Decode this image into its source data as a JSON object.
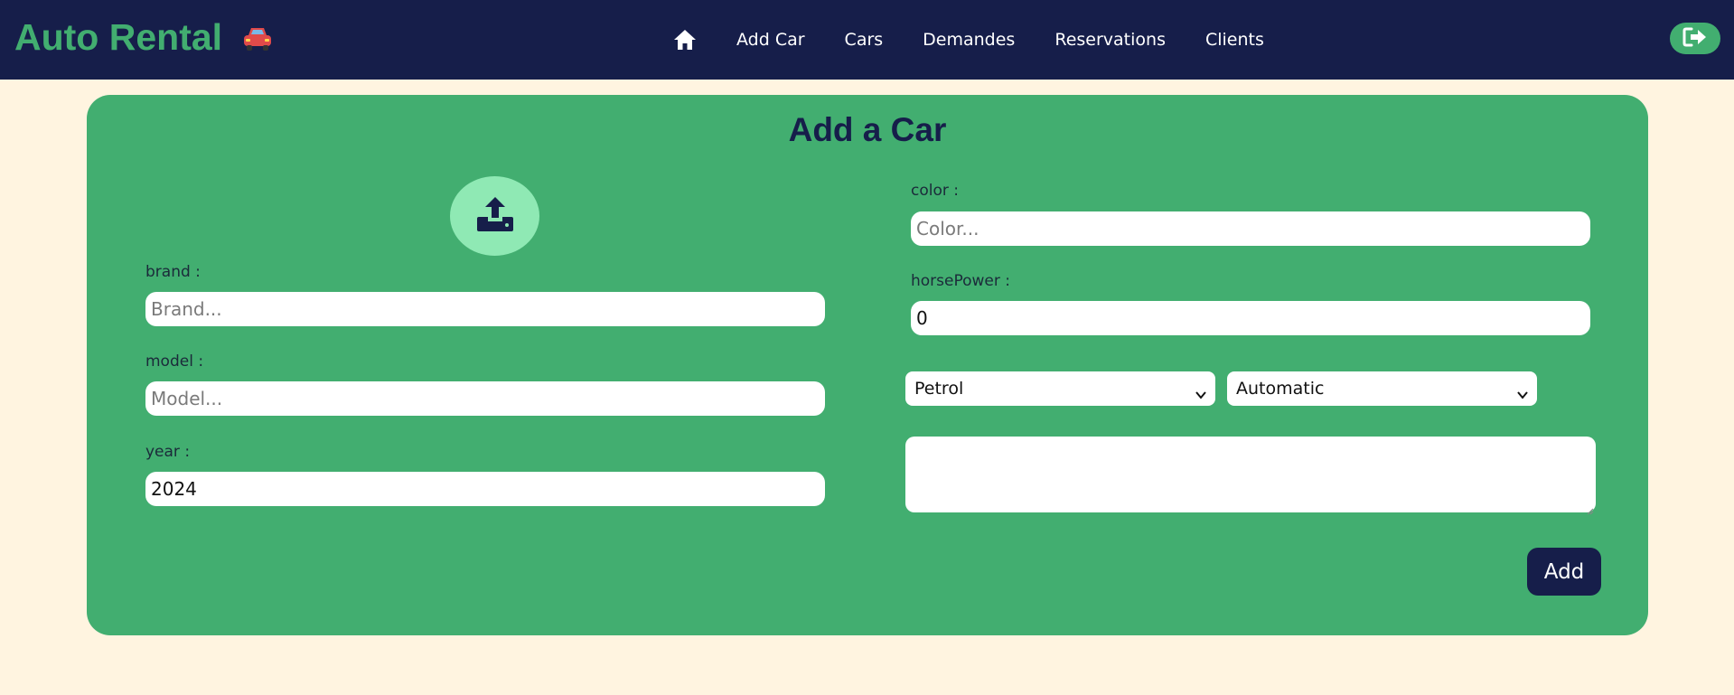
{
  "navbar": {
    "brand": "Auto Rental",
    "brand_icon": "car-icon",
    "links": [
      "Add Car",
      "Cars",
      "Demandes",
      "Reservations",
      "Clients"
    ],
    "home_icon": "home-icon",
    "logout_icon": "sign-out-icon"
  },
  "form": {
    "title": "Add a Car",
    "upload_icon": "upload-icon",
    "brand": {
      "label": "brand :",
      "placeholder": "Brand...",
      "value": ""
    },
    "model": {
      "label": "model :",
      "placeholder": "Model...",
      "value": ""
    },
    "year": {
      "label": "year :",
      "value": "2024"
    },
    "color": {
      "label": "color :",
      "placeholder": "Color...",
      "value": ""
    },
    "horsepower": {
      "label": "horsePower :",
      "value": "0"
    },
    "fuel_select": "Petrol",
    "transmission_select": "Automatic",
    "description": "",
    "submit_label": "Add"
  },
  "colors": {
    "navbar": "#161e4a",
    "accent_green": "#42ae70",
    "upload_circle": "#8fe9b4",
    "page_background": "#fff4e0"
  }
}
